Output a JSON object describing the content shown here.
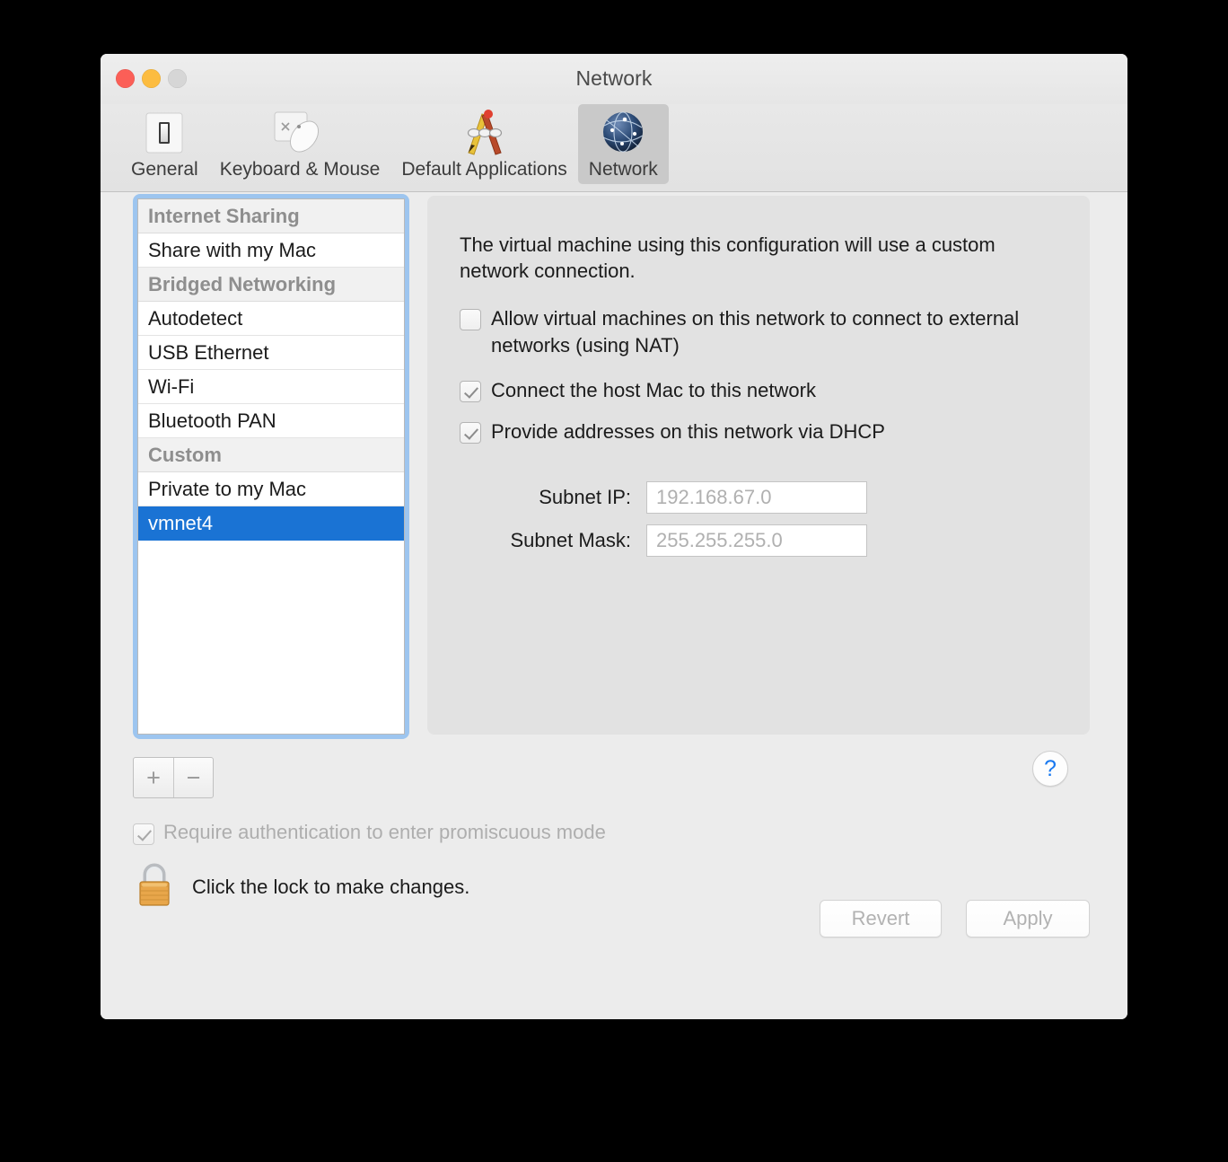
{
  "window": {
    "title": "Network",
    "traffic_lights": [
      "close",
      "minimize",
      "zoom"
    ]
  },
  "toolbar": {
    "tabs": [
      {
        "label": "General",
        "icon": "light-switch-icon",
        "selected": false
      },
      {
        "label": "Keyboard & Mouse",
        "icon": "trackpad-mouse-icon",
        "selected": false
      },
      {
        "label": "Default Applications",
        "icon": "pencil-brush-chain-icon",
        "selected": false
      },
      {
        "label": "Network",
        "icon": "globe-network-icon",
        "selected": true
      }
    ]
  },
  "sidebar": {
    "rows": [
      {
        "label": "Internet Sharing",
        "type": "group"
      },
      {
        "label": "Share with my Mac",
        "type": "item"
      },
      {
        "label": "Bridged Networking",
        "type": "group"
      },
      {
        "label": "Autodetect",
        "type": "item"
      },
      {
        "label": "USB Ethernet",
        "type": "item"
      },
      {
        "label": "Wi-Fi",
        "type": "item"
      },
      {
        "label": "Bluetooth PAN",
        "type": "item"
      },
      {
        "label": "Custom",
        "type": "group"
      },
      {
        "label": "Private to my Mac",
        "type": "item"
      },
      {
        "label": "vmnet4",
        "type": "item",
        "selected": true
      }
    ],
    "add_label": "+",
    "remove_label": "−"
  },
  "panel": {
    "description": "The virtual machine using this configuration will use a custom network connection.",
    "checkboxes": [
      {
        "label": "Allow virtual machines on this network to connect to external networks (using NAT)",
        "checked": false
      },
      {
        "label": "Connect the host Mac to this network",
        "checked": true
      },
      {
        "label": "Provide addresses on this network via DHCP",
        "checked": true
      }
    ],
    "fields": [
      {
        "label": "Subnet IP:",
        "value": "192.168.67.0"
      },
      {
        "label": "Subnet Mask:",
        "value": "255.255.255.0"
      }
    ]
  },
  "footer": {
    "help_label": "?",
    "promiscuous": {
      "label": "Require authentication to enter promiscuous mode",
      "checked": true
    },
    "lock": {
      "icon": "padlock-closed-icon",
      "text": "Click the lock to make changes."
    },
    "revert_label": "Revert",
    "apply_label": "Apply"
  },
  "colors": {
    "selection_blue": "#1a73d4",
    "focus_ring": "#9dc5ef",
    "accent_link": "#1878f0",
    "window_bg": "#ececec",
    "panel_bg": "#e2e2e2"
  }
}
